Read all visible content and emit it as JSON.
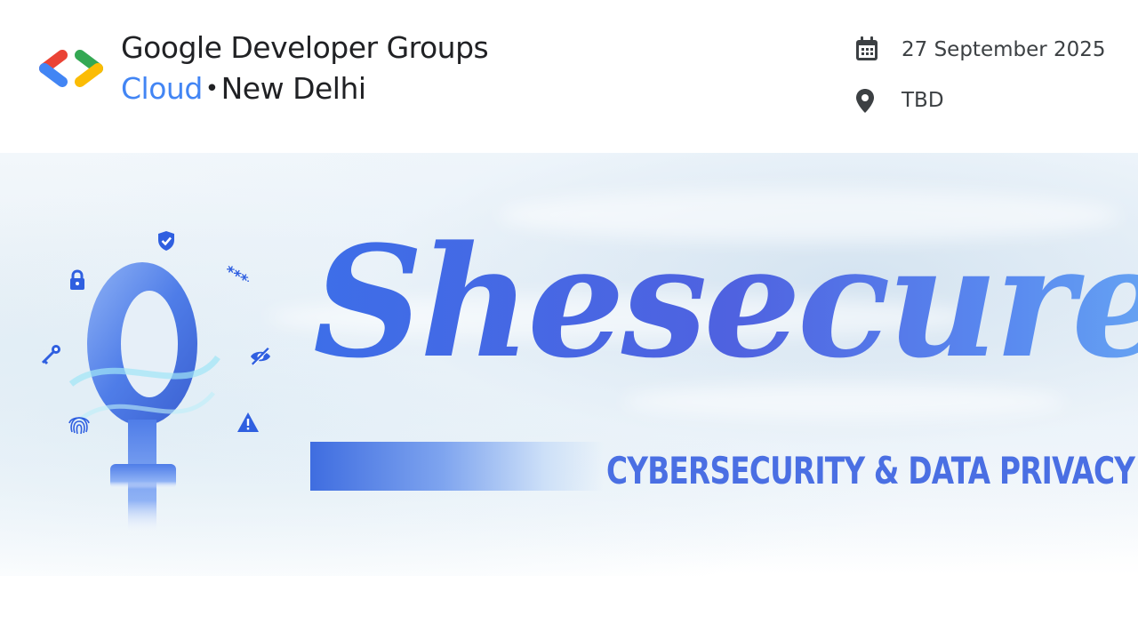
{
  "header": {
    "org_name": "Google Developer Groups",
    "chapter_prefix": "Cloud",
    "chapter_separator": "•",
    "chapter_city": "New Delhi",
    "logo_icon": "gdg-logo-icon"
  },
  "event": {
    "date": "27 September 2025",
    "date_icon": "calendar-icon",
    "location": "TBD",
    "location_icon": "location-pin-icon"
  },
  "banner": {
    "title": "Shesecures",
    "subtitle": "CYBERSECURITY & DATA PRIVACY",
    "symbol_icon": "female-symbol-icon",
    "decor_icons": [
      "shield-check-icon",
      "lock-icon",
      "password-asterisks-icon",
      "key-icon",
      "eye-off-icon",
      "fingerprint-icon",
      "warning-icon"
    ],
    "password_mask": "****"
  },
  "colors": {
    "google_blue": "#4285f4",
    "google_red": "#ea4335",
    "google_yellow": "#fbbc04",
    "google_green": "#34a853",
    "title_blue": "#4f62e0",
    "subtitle_blue": "#4a6fe3"
  }
}
